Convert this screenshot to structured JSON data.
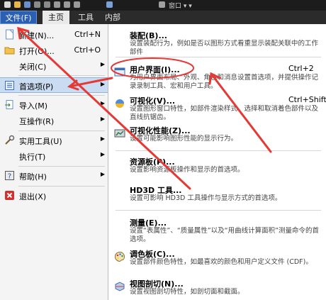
{
  "window": {
    "title": "窗口 ▾ ▾",
    "accent": "#2a5fb3"
  },
  "ribbon": {
    "tabs": [
      {
        "label": "文件(F)"
      },
      {
        "label": "主页"
      },
      {
        "label": "工具"
      },
      {
        "label": "内部"
      }
    ]
  },
  "file_menu": {
    "items": [
      {
        "label": "新建(N)...",
        "shortcut": "Ctrl+N",
        "icon": "new-document-icon"
      },
      {
        "label": "打开(O)...",
        "shortcut": "Ctrl+O",
        "icon": "open-folder-icon"
      },
      {
        "label": "关闭(C)"
      },
      {
        "label": "首选项(P)",
        "icon": "preferences-icon",
        "highlighted": true
      },
      {
        "label": "导入(M)",
        "icon": "import-icon"
      },
      {
        "label": "互操作(R)"
      },
      {
        "label": "实用工具(U)",
        "icon": "utilities-icon"
      },
      {
        "label": "执行(T)"
      },
      {
        "label": "帮助(H)",
        "icon": "help-icon"
      },
      {
        "label": "退出(X)",
        "icon": "exit-icon"
      }
    ]
  },
  "preferences_submenu": {
    "items": [
      {
        "title": "装配(B)...",
        "desc": "设置装配行为，例如是否以图形方式看重显示装配关联中的工作部件"
      },
      {
        "title": "用户界面(I)...",
        "shortcut": "Ctrl+2",
        "desc": "为用户界面布局、外观、角色和消息设置首选项，并提供操作记录录制工具、宏和用户工具。"
      },
      {
        "title": "可视化(V)...",
        "shortcut": "Ctrl+Shift+V",
        "desc": "设置图形窗口特性，如部件渲染样式、选择和取消着色部件以及直线抗锯齿。"
      },
      {
        "title": "可视化性能(Z)...",
        "desc": "设置可能影响图形性能的显示行为。"
      },
      {
        "title": "资源板(P)...",
        "desc": "设置影响资源板操作和显示的首选项。"
      },
      {
        "title": "HD3D 工具...",
        "desc": "设置可影响 HD3D 工具操作与显示方式的首选项。"
      },
      {
        "title": "测量(E)...",
        "desc": "设置“表属性”、“质量属性”以及“用曲线计算面积”测量命令的首选项。"
      },
      {
        "title": "调色板(C)...",
        "desc": "设置部件颜色特性，如最喜欢的颜色和用户定义文件 (CDF)。"
      },
      {
        "title": "视图剖切(N)...",
        "desc": "设置视图剖切特性，如剖切面和截面。"
      }
    ]
  },
  "annotation": {
    "color": "#e53935"
  }
}
